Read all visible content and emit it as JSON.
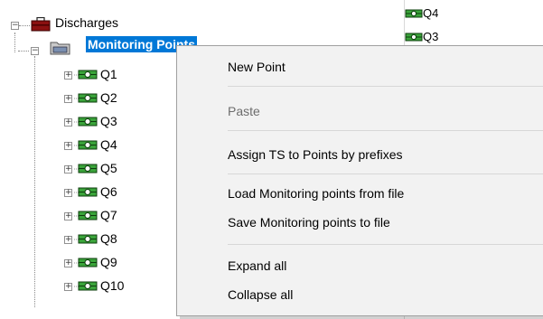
{
  "tree": {
    "root": {
      "label": "Discharges",
      "icon": "briefcase-icon",
      "expander": "−"
    },
    "folder": {
      "label": "Monitoring Points",
      "icon": "folder-icon",
      "expander": "−"
    },
    "points": [
      {
        "label": "Q1"
      },
      {
        "label": "Q2"
      },
      {
        "label": "Q3"
      },
      {
        "label": "Q4"
      },
      {
        "label": "Q5"
      },
      {
        "label": "Q6"
      },
      {
        "label": "Q7"
      },
      {
        "label": "Q8"
      },
      {
        "label": "Q9"
      },
      {
        "label": "Q10"
      }
    ],
    "point_expander": "+"
  },
  "right_pane": {
    "items": [
      {
        "label": "Q4"
      },
      {
        "label": "Q3"
      }
    ]
  },
  "context_menu": {
    "new_point": "New Point",
    "paste": "Paste",
    "assign_ts": "Assign TS to Points by prefixes",
    "load_points": "Load Monitoring points from file",
    "save_points": "Save Monitoring points to file",
    "expand_all": "Expand all",
    "collapse_all": "Collapse all"
  },
  "colors": {
    "selection": "#0078d7",
    "menu_background": "#f2f2f2",
    "point_icon": "#2e8b2e",
    "briefcase": "#8b1010"
  }
}
